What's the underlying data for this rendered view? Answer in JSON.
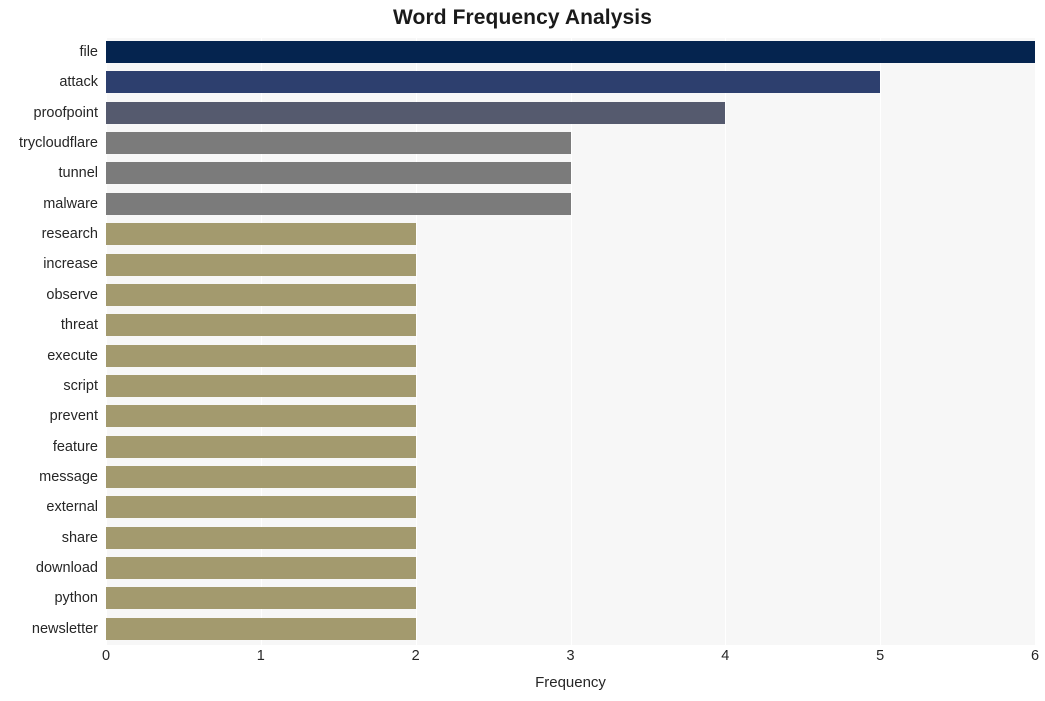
{
  "chart_data": {
    "type": "bar",
    "orientation": "horizontal",
    "title": "Word Frequency Analysis",
    "xlabel": "Frequency",
    "ylabel": "",
    "xlim": [
      0,
      6
    ],
    "xticks": [
      "0",
      "1",
      "2",
      "3",
      "4",
      "5",
      "6"
    ],
    "grid": true,
    "legend": false,
    "categories": [
      "file",
      "attack",
      "proofpoint",
      "trycloudflare",
      "tunnel",
      "malware",
      "research",
      "increase",
      "observe",
      "threat",
      "execute",
      "script",
      "prevent",
      "feature",
      "message",
      "external",
      "share",
      "download",
      "python",
      "newsletter"
    ],
    "values": [
      6,
      5,
      4,
      3,
      3,
      3,
      2,
      2,
      2,
      2,
      2,
      2,
      2,
      2,
      2,
      2,
      2,
      2,
      2,
      2
    ],
    "bar_colors": [
      "#05244f",
      "#2d3f6e",
      "#555a6e",
      "#7b7b7b",
      "#7b7b7b",
      "#7b7b7b",
      "#a39a6e",
      "#a39a6e",
      "#a39a6e",
      "#a39a6e",
      "#a39a6e",
      "#a39a6e",
      "#a39a6e",
      "#a39a6e",
      "#a39a6e",
      "#a39a6e",
      "#a39a6e",
      "#a39a6e",
      "#a39a6e",
      "#a39a6e"
    ]
  },
  "style": {
    "figure_background": "#ffffff",
    "plot_background": "#f7f7f7",
    "gridline_color": "#ffffff",
    "text_color": "#262626"
  }
}
